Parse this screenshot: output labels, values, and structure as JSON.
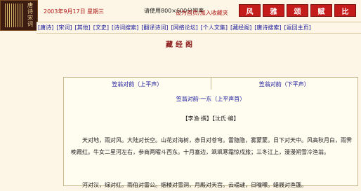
{
  "header": {
    "logo_text": "唐诗宋词",
    "date_line": "2003年9月17日 星期三",
    "resolution_note": "请使用800×600分辨率",
    "homepage_link": "设为首页/加入收藏夹",
    "seals": [
      "风",
      "雅",
      "颂",
      "赋",
      "比"
    ]
  },
  "nav": [
    "[唐诗]",
    "[宋词]",
    "[其他]",
    "[文史]",
    "[诗词搜索]",
    "[翻译诗词]",
    "[网络论坛]",
    "[个人文集]",
    "[藏经阁]",
    "[唐诗搜索]",
    "[返回主页]"
  ],
  "page_title": "藏经阁",
  "subnav": [
    "笠翁对韵（上平声）",
    "笠翁对韵（下平声）"
  ],
  "section_heading": "笠翁对韵·一东（上平声首）",
  "author_line": "【李渔·撰】【沈氏·编】",
  "paragraphs": [
    "天对地，雨对风。大陆对长空。山花对海树，赤日对苍穹。雷隐隐，雾蒙蒙。日下对天中。风高秋月白，雨霁晚霞红。牛女二星河左右，参商两曜斗西东。十月塞边，飒飒寒霜惊戍旅；三冬江上，漫漫朔雪冷渔翁。",
    "河对汉，绿对红。雨伯对雷公。烟楼对雪洞，月殿对天宫。云叆叇，日曈曚。蜡屐对渔篷。"
  ]
}
